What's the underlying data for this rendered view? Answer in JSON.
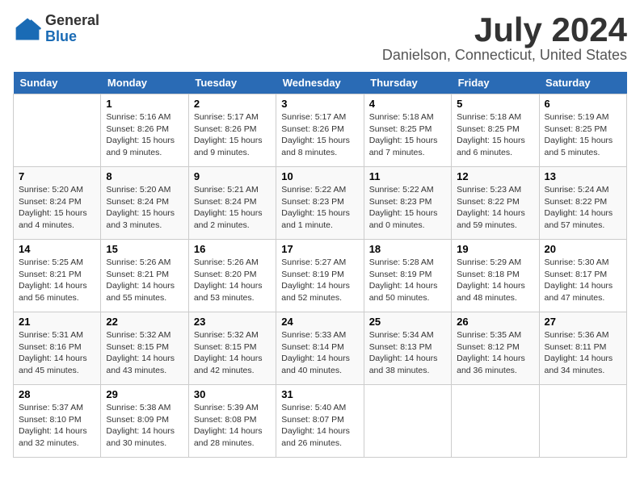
{
  "logo": {
    "general": "General",
    "blue": "Blue"
  },
  "title": {
    "month_year": "July 2024",
    "location": "Danielson, Connecticut, United States"
  },
  "calendar": {
    "headers": [
      "Sunday",
      "Monday",
      "Tuesday",
      "Wednesday",
      "Thursday",
      "Friday",
      "Saturday"
    ],
    "weeks": [
      [
        {
          "day": "",
          "info": ""
        },
        {
          "day": "1",
          "info": "Sunrise: 5:16 AM\nSunset: 8:26 PM\nDaylight: 15 hours\nand 9 minutes."
        },
        {
          "day": "2",
          "info": "Sunrise: 5:17 AM\nSunset: 8:26 PM\nDaylight: 15 hours\nand 9 minutes."
        },
        {
          "day": "3",
          "info": "Sunrise: 5:17 AM\nSunset: 8:26 PM\nDaylight: 15 hours\nand 8 minutes."
        },
        {
          "day": "4",
          "info": "Sunrise: 5:18 AM\nSunset: 8:25 PM\nDaylight: 15 hours\nand 7 minutes."
        },
        {
          "day": "5",
          "info": "Sunrise: 5:18 AM\nSunset: 8:25 PM\nDaylight: 15 hours\nand 6 minutes."
        },
        {
          "day": "6",
          "info": "Sunrise: 5:19 AM\nSunset: 8:25 PM\nDaylight: 15 hours\nand 5 minutes."
        }
      ],
      [
        {
          "day": "7",
          "info": "Sunrise: 5:20 AM\nSunset: 8:24 PM\nDaylight: 15 hours\nand 4 minutes."
        },
        {
          "day": "8",
          "info": "Sunrise: 5:20 AM\nSunset: 8:24 PM\nDaylight: 15 hours\nand 3 minutes."
        },
        {
          "day": "9",
          "info": "Sunrise: 5:21 AM\nSunset: 8:24 PM\nDaylight: 15 hours\nand 2 minutes."
        },
        {
          "day": "10",
          "info": "Sunrise: 5:22 AM\nSunset: 8:23 PM\nDaylight: 15 hours\nand 1 minute."
        },
        {
          "day": "11",
          "info": "Sunrise: 5:22 AM\nSunset: 8:23 PM\nDaylight: 15 hours\nand 0 minutes."
        },
        {
          "day": "12",
          "info": "Sunrise: 5:23 AM\nSunset: 8:22 PM\nDaylight: 14 hours\nand 59 minutes."
        },
        {
          "day": "13",
          "info": "Sunrise: 5:24 AM\nSunset: 8:22 PM\nDaylight: 14 hours\nand 57 minutes."
        }
      ],
      [
        {
          "day": "14",
          "info": "Sunrise: 5:25 AM\nSunset: 8:21 PM\nDaylight: 14 hours\nand 56 minutes."
        },
        {
          "day": "15",
          "info": "Sunrise: 5:26 AM\nSunset: 8:21 PM\nDaylight: 14 hours\nand 55 minutes."
        },
        {
          "day": "16",
          "info": "Sunrise: 5:26 AM\nSunset: 8:20 PM\nDaylight: 14 hours\nand 53 minutes."
        },
        {
          "day": "17",
          "info": "Sunrise: 5:27 AM\nSunset: 8:19 PM\nDaylight: 14 hours\nand 52 minutes."
        },
        {
          "day": "18",
          "info": "Sunrise: 5:28 AM\nSunset: 8:19 PM\nDaylight: 14 hours\nand 50 minutes."
        },
        {
          "day": "19",
          "info": "Sunrise: 5:29 AM\nSunset: 8:18 PM\nDaylight: 14 hours\nand 48 minutes."
        },
        {
          "day": "20",
          "info": "Sunrise: 5:30 AM\nSunset: 8:17 PM\nDaylight: 14 hours\nand 47 minutes."
        }
      ],
      [
        {
          "day": "21",
          "info": "Sunrise: 5:31 AM\nSunset: 8:16 PM\nDaylight: 14 hours\nand 45 minutes."
        },
        {
          "day": "22",
          "info": "Sunrise: 5:32 AM\nSunset: 8:15 PM\nDaylight: 14 hours\nand 43 minutes."
        },
        {
          "day": "23",
          "info": "Sunrise: 5:32 AM\nSunset: 8:15 PM\nDaylight: 14 hours\nand 42 minutes."
        },
        {
          "day": "24",
          "info": "Sunrise: 5:33 AM\nSunset: 8:14 PM\nDaylight: 14 hours\nand 40 minutes."
        },
        {
          "day": "25",
          "info": "Sunrise: 5:34 AM\nSunset: 8:13 PM\nDaylight: 14 hours\nand 38 minutes."
        },
        {
          "day": "26",
          "info": "Sunrise: 5:35 AM\nSunset: 8:12 PM\nDaylight: 14 hours\nand 36 minutes."
        },
        {
          "day": "27",
          "info": "Sunrise: 5:36 AM\nSunset: 8:11 PM\nDaylight: 14 hours\nand 34 minutes."
        }
      ],
      [
        {
          "day": "28",
          "info": "Sunrise: 5:37 AM\nSunset: 8:10 PM\nDaylight: 14 hours\nand 32 minutes."
        },
        {
          "day": "29",
          "info": "Sunrise: 5:38 AM\nSunset: 8:09 PM\nDaylight: 14 hours\nand 30 minutes."
        },
        {
          "day": "30",
          "info": "Sunrise: 5:39 AM\nSunset: 8:08 PM\nDaylight: 14 hours\nand 28 minutes."
        },
        {
          "day": "31",
          "info": "Sunrise: 5:40 AM\nSunset: 8:07 PM\nDaylight: 14 hours\nand 26 minutes."
        },
        {
          "day": "",
          "info": ""
        },
        {
          "day": "",
          "info": ""
        },
        {
          "day": "",
          "info": ""
        }
      ]
    ]
  }
}
